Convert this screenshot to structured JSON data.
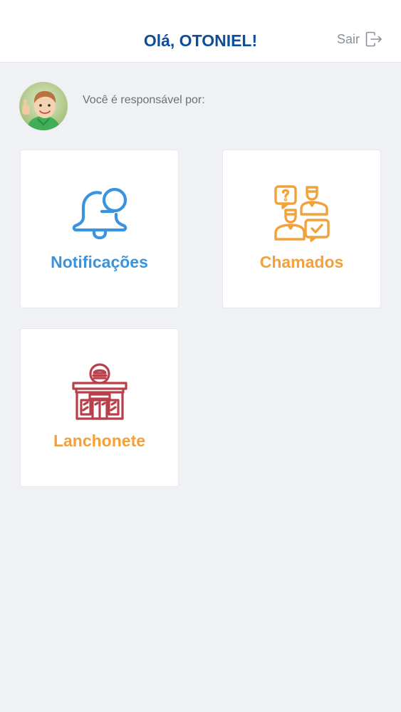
{
  "header": {
    "title": "Olá, OTONIEL!",
    "logout_label": "Sair",
    "logout_icon": "logout-icon",
    "title_color": "#0d4f9a"
  },
  "profile": {
    "avatar": "avatar-photo",
    "responsible_text": "Você é responsável por:"
  },
  "cards": [
    {
      "label": "Notificações",
      "icon": "bell-icon",
      "color": "#3a93df"
    },
    {
      "label": "Chamados",
      "icon": "support-chat-icon",
      "color": "#f2a13c"
    },
    {
      "label": "Lanchonete",
      "icon": "snack-bar-icon",
      "label_color": "#f2a13c",
      "icon_color": "#b7414b"
    }
  ]
}
